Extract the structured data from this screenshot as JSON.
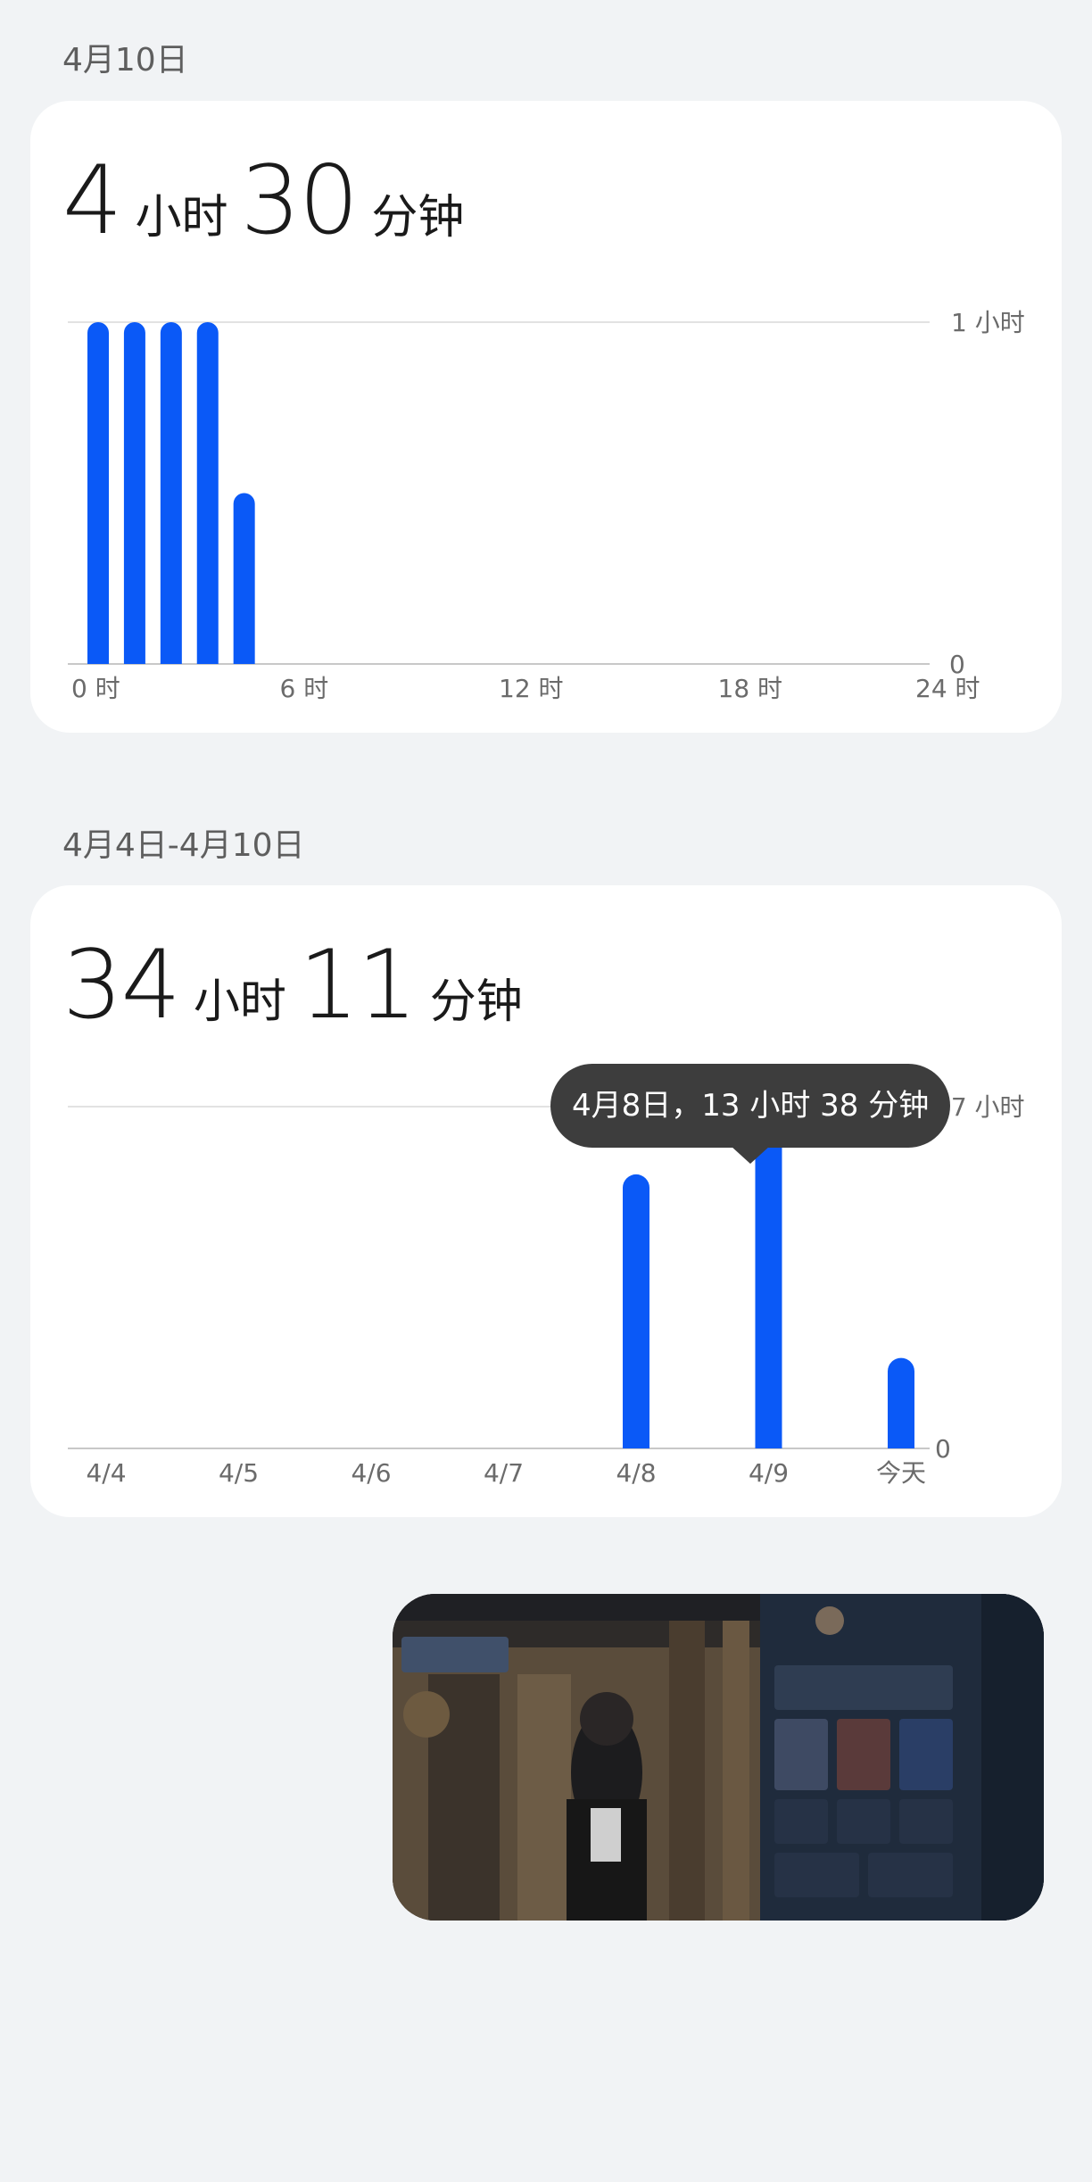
{
  "daily": {
    "date_label": "4月10日",
    "total_hours": "4",
    "hours_unit": "小时",
    "total_minutes": "30",
    "minutes_unit": "分钟",
    "y_top_label": "1 小时",
    "y_bottom_label": "0",
    "x_labels": [
      "0 时",
      "6 时",
      "12 时",
      "18 时",
      "24 时"
    ]
  },
  "weekly": {
    "date_label": "4月4日-4月10日",
    "total_hours": "34",
    "hours_unit": "小时",
    "total_minutes": "11",
    "minutes_unit": "分钟",
    "y_top_label": "17 小时",
    "y_bottom_label": "0",
    "x_labels": [
      "4/4",
      "4/5",
      "4/6",
      "4/7",
      "4/8",
      "4/9",
      "今天"
    ],
    "tooltip": "4月8日，13 小时 38 分钟"
  },
  "colors": {
    "bar": "#0a59f7",
    "tooltip_bg": "#3d3d3d",
    "background": "#f1f3f5"
  },
  "chart_data": [
    {
      "type": "bar",
      "x": [
        "0 时",
        "1 时",
        "2 时",
        "3 时",
        "4 时",
        "5 时",
        "6 时",
        "7 时",
        "8 时",
        "9 时",
        "10 时",
        "11 时",
        "12 时",
        "13 时",
        "14 时",
        "15 时",
        "16 时",
        "17 时",
        "18 时",
        "19 时",
        "20 时",
        "21 时",
        "22 时",
        "23 时"
      ],
      "values": [
        60,
        60,
        60,
        60,
        30,
        0,
        0,
        0,
        0,
        0,
        0,
        0,
        0,
        0,
        0,
        0,
        0,
        0,
        0,
        0,
        0,
        0,
        0,
        0
      ],
      "unit": "minutes",
      "ylim": [
        0,
        60
      ],
      "grid": true
    },
    {
      "type": "bar",
      "categories": [
        "4/4",
        "4/5",
        "4/6",
        "4/7",
        "4/8",
        "4/9",
        "今天"
      ],
      "values": [
        0,
        0,
        0,
        0,
        13.63,
        16,
        4.5
      ],
      "unit": "hours",
      "ylim": [
        0,
        17
      ],
      "grid": true
    }
  ],
  "thumbnail": {
    "icon": "game-screenshot-thumbnail"
  }
}
